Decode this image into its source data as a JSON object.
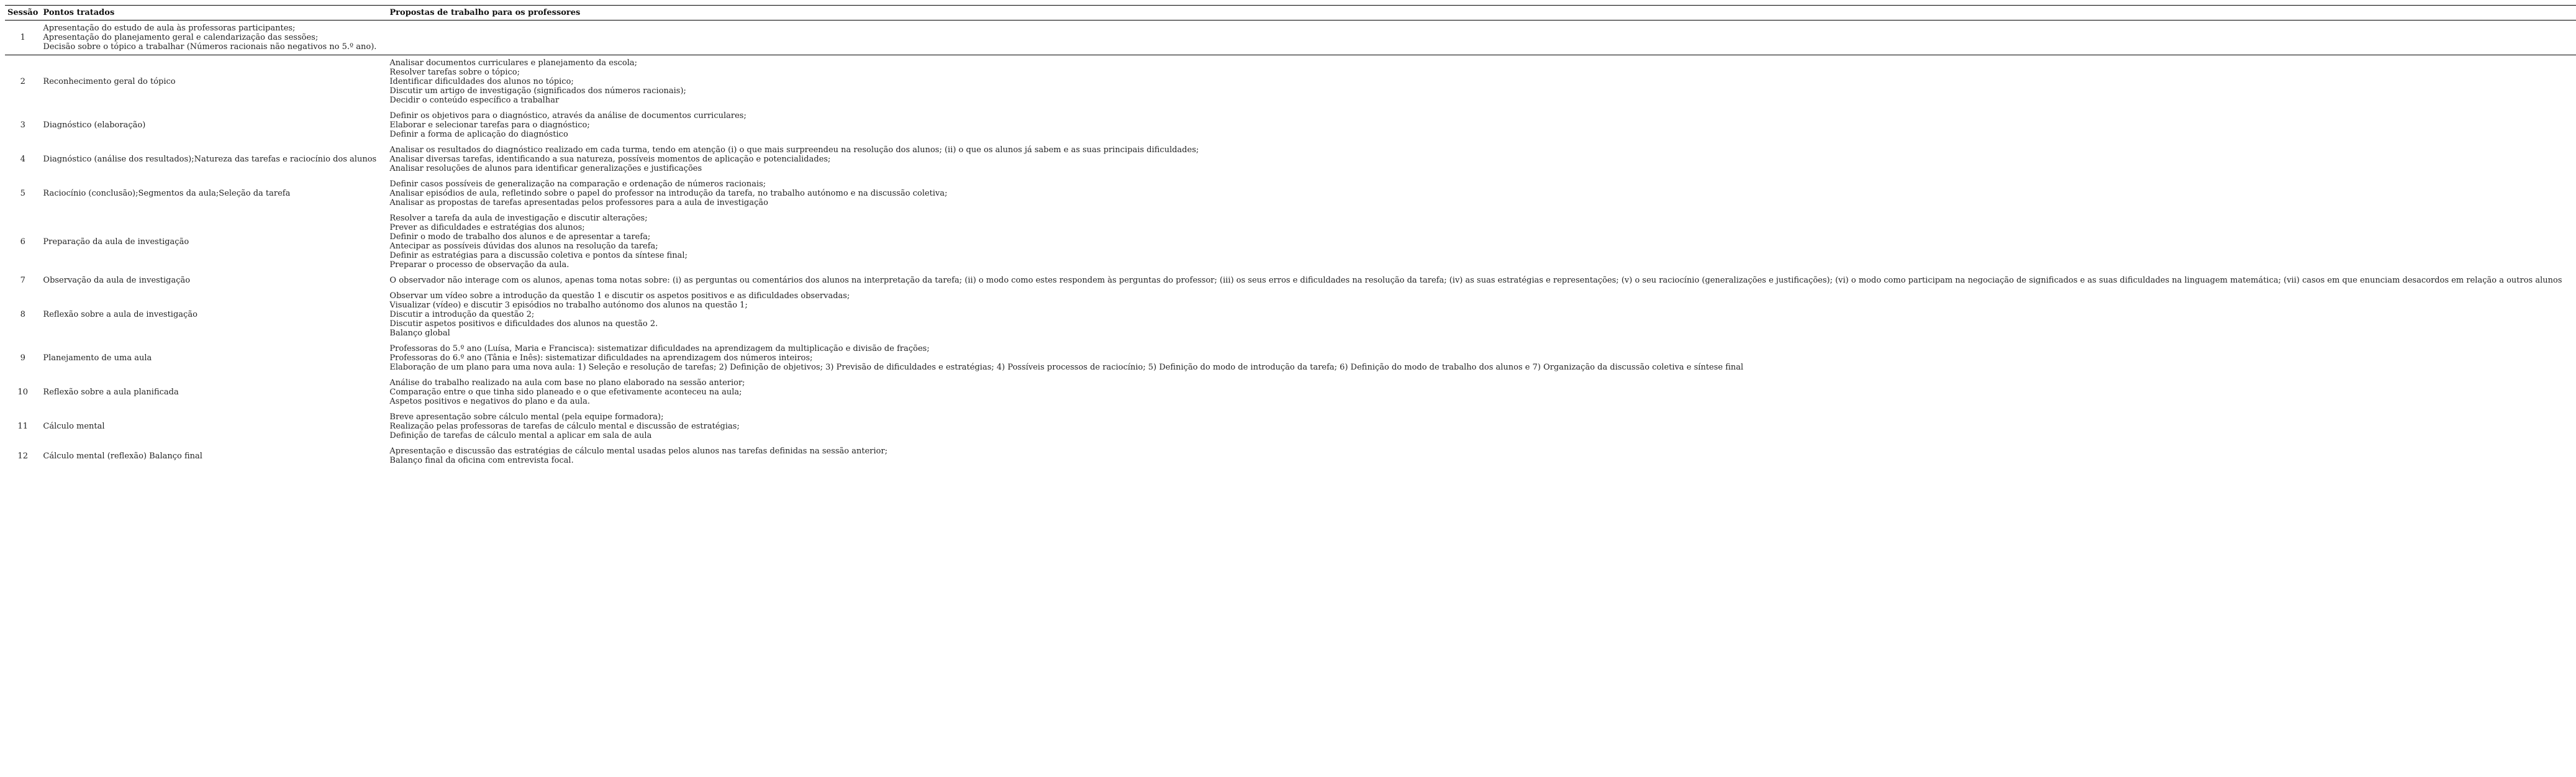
{
  "table": {
    "headers": {
      "session": "Sessão",
      "points": "Pontos tratados",
      "proposals": "Propostas de trabalho para os professores"
    },
    "rows": [
      {
        "session": "1",
        "points": [
          "Apresentação do estudo de aula às professoras participantes;",
          "Apresentação do planejamento geral e calendarização das sessões;",
          "Decisão sobre o tópico a trabalhar (Números racionais não negativos no 5.º ano)."
        ],
        "proposals": []
      },
      {
        "session": "2",
        "points": [
          "Reconhecimento geral do tópico"
        ],
        "proposals": [
          "Analisar documentos curriculares e planejamento da escola;",
          "Resolver tarefas sobre o tópico;",
          "Identificar dificuldades dos alunos no tópico;",
          "Discutir um artigo de investigação (significados dos números racionais);",
          "Decidir o conteúdo específico a trabalhar"
        ]
      },
      {
        "session": "3",
        "points": [
          "Diagnóstico (elaboração)"
        ],
        "proposals": [
          "Definir os objetivos para o diagnóstico, através da análise de documentos curriculares;",
          "Elaborar e selecionar tarefas para o diagnóstico;",
          "Definir a forma de aplicação do diagnóstico"
        ]
      },
      {
        "session": "4",
        "points": [
          "Diagnóstico (análise dos resultados);Natureza das tarefas e raciocínio dos alunos"
        ],
        "proposals": [
          "Analisar os resultados do diagnóstico realizado em cada turma, tendo em atenção (i) o que mais surpreendeu na resolução dos alunos; (ii) o que os alunos já sabem e as suas principais dificuldades;",
          "Analisar diversas tarefas, identificando a sua natureza, possíveis momentos de aplicação e potencialidades;",
          "Analisar resoluções de alunos para identificar generalizações e justificações"
        ]
      },
      {
        "session": "5",
        "points": [
          "Raciocínio (conclusão);Segmentos da aula;Seleção da tarefa"
        ],
        "proposals": [
          "Definir casos possíveis de generalização na comparação e ordenação de números racionais;",
          "Analisar episódios de aula, refletindo sobre o papel do professor na introdução da tarefa, no trabalho autónomo e na discussão coletiva;",
          "Analisar as propostas de tarefas apresentadas pelos professores para a aula de investigação"
        ]
      },
      {
        "session": "6",
        "points": [
          "Preparação da aula de investigação"
        ],
        "proposals": [
          "Resolver a tarefa da aula de investigação e discutir alterações;",
          "Prever as dificuldades e estratégias dos alunos;",
          "Definir o modo de trabalho dos alunos e de apresentar a tarefa;",
          "Antecipar as possíveis dúvidas dos alunos na resolução da tarefa;",
          "Definir as estratégias para a discussão coletiva e pontos da síntese final;",
          "Preparar o processo de observação da aula."
        ]
      },
      {
        "session": "7",
        "points": [
          "Observação da aula de investigação"
        ],
        "proposals": [
          "O observador não interage com os alunos, apenas toma notas sobre: (i) as perguntas ou comentários dos alunos na interpretação da tarefa; (ii) o modo como estes respondem às perguntas do professor; (iii) os seus erros e dificuldades na resolução da tarefa; (iv) as suas estratégias e representações; (v) o seu raciocínio (generalizações e justificações); (vi) o modo como participam na negociação de significados e as suas dificuldades na linguagem matemática; (vii) casos em que enunciam desacordos em relação a outros alunos"
        ]
      },
      {
        "session": "8",
        "points": [
          "Reflexão sobre a aula de investigação"
        ],
        "proposals": [
          "Observar um vídeo sobre a introdução da questão 1 e discutir os aspetos positivos e as dificuldades observadas;",
          "Visualizar (vídeo) e discutir 3 episódios no trabalho autónomo dos alunos na questão 1;",
          "Discutir a introdução da questão 2;",
          "Discutir aspetos positivos e dificuldades dos alunos na questão 2.",
          "Balanço global"
        ]
      },
      {
        "session": "9",
        "points": [
          "Planejamento de uma aula"
        ],
        "proposals": [
          "Professoras do 5.º ano (Luísa, Maria e Francisca): sistematizar dificuldades na aprendizagem da multiplicação e divisão de frações;",
          "Professoras do 6.º ano (Tânia e Inês): sistematizar dificuldades na aprendizagem dos números inteiros;",
          "Elaboração de um plano para uma nova aula: 1) Seleção e resolução de tarefas; 2) Definição de objetivos; 3) Previsão de dificuldades e estratégias; 4) Possíveis processos de raciocínio; 5) Definição do modo de introdução da tarefa; 6) Definição do modo de trabalho dos alunos e 7) Organização da discussão coletiva e síntese final"
        ]
      },
      {
        "session": "10",
        "points": [
          "Reflexão sobre a aula planificada"
        ],
        "proposals": [
          "Análise do trabalho realizado na aula com base no plano elaborado na sessão anterior;",
          "Comparação entre o que tinha sido planeado e o que efetivamente aconteceu na aula;",
          "Aspetos positivos e negativos do plano e da aula."
        ]
      },
      {
        "session": "11",
        "points": [
          "Cálculo mental"
        ],
        "proposals": [
          "Breve apresentação sobre cálculo mental (pela equipe formadora);",
          "Realização pelas professoras de tarefas de cálculo mental e discussão de estratégias;",
          "Definição de tarefas de cálculo mental a aplicar em sala de aula"
        ]
      },
      {
        "session": "12",
        "points": [
          "Cálculo mental (reflexão) Balanço final"
        ],
        "proposals": [
          "Apresentação e discussão das estratégias de cálculo mental usadas pelos alunos nas tarefas definidas na sessão anterior;",
          "Balanço final da oficina com entrevista focal."
        ]
      }
    ]
  }
}
